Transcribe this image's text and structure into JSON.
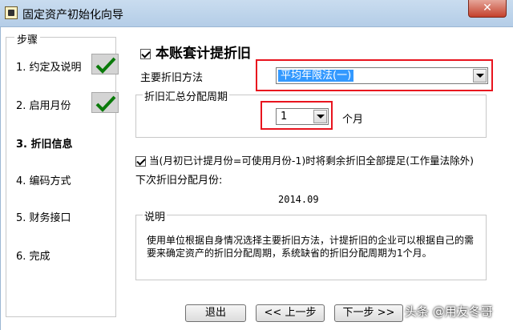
{
  "window": {
    "title": "固定资产初始化向导",
    "close_label": "✕"
  },
  "steps": {
    "title": "步骤",
    "items": [
      {
        "label": "1. 约定及说明",
        "done": true
      },
      {
        "label": "2. 启用月份",
        "done": true
      },
      {
        "label": "3. 折旧信息",
        "active": true
      },
      {
        "label": "4. 编码方式"
      },
      {
        "label": "5. 财务接口"
      },
      {
        "label": "6. 完成"
      }
    ]
  },
  "main": {
    "depreciation_checkbox": "本账套计提折旧",
    "method_label": "主要折旧方法",
    "method_value": "平均年限法(一)",
    "period_group_title": "折旧汇总分配周期",
    "period_value": "1",
    "period_unit": "个月",
    "final_month_checkbox": "当(月初已计提月份=可使用月份-1)时将剩余折旧全部提足(工作量法除外)",
    "next_period_label": "下次折旧分配月份:",
    "next_period_value": "2014.09",
    "note_title": "说明",
    "note_text": "使用单位根据自身情况选择主要折旧方法，计提折旧的企业可以根据自己的需要来确定资产的折旧分配周期，系统缺省的折旧分配周期为1个月。"
  },
  "buttons": {
    "exit": "退出",
    "prev": "<< 上一步",
    "next": "下一步 >>"
  },
  "watermark": "头条 @用友冬哥",
  "colors": {
    "highlight": "#3399ff",
    "annotation": "#e8141e",
    "check": "#0a7a0a"
  }
}
